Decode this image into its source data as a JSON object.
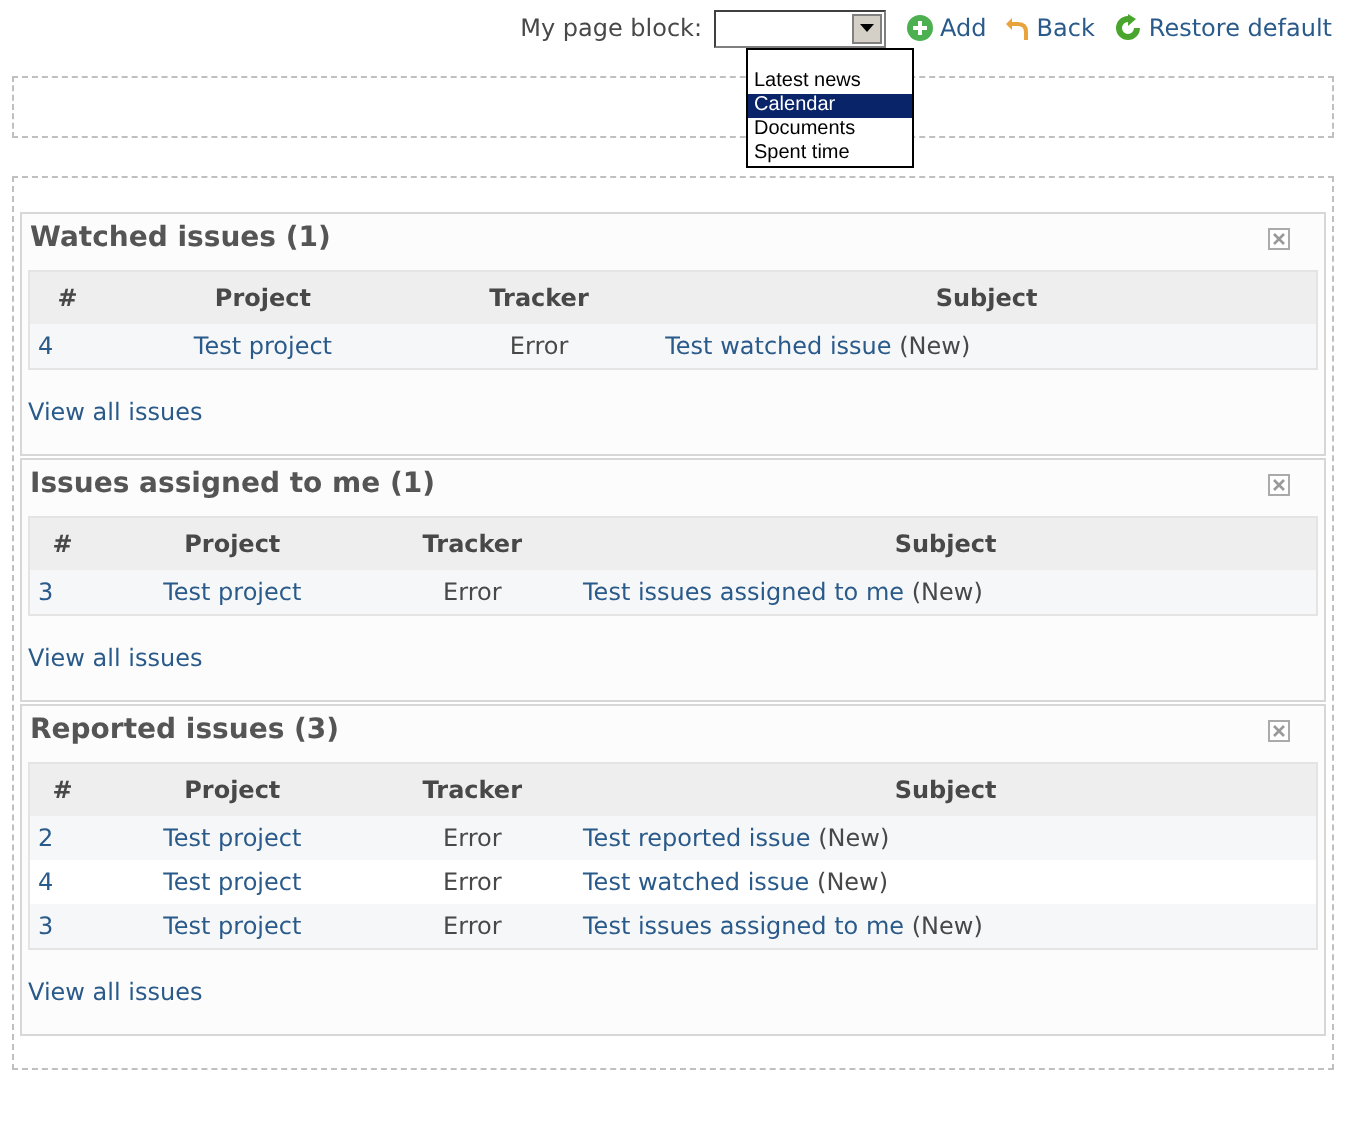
{
  "toolbar": {
    "label": "My page block:",
    "add": "Add",
    "back": "Back",
    "restore": "Restore default"
  },
  "block_menu": {
    "options": [
      {
        "label": "Latest news",
        "selected": false
      },
      {
        "label": "Calendar",
        "selected": true
      },
      {
        "label": "Documents",
        "selected": false
      },
      {
        "label": "Spent time",
        "selected": false
      }
    ]
  },
  "blocks": [
    {
      "title": "Watched issues (1)",
      "columns": [
        "#",
        "Project",
        "Tracker",
        "Subject"
      ],
      "rows": [
        {
          "id": "4",
          "project": "Test project",
          "tracker": "Error",
          "subject": "Test watched issue",
          "status": "(New)"
        }
      ],
      "footer_link": "View all issues"
    },
    {
      "title": "Issues assigned to me (1)",
      "columns": [
        "#",
        "Project",
        "Tracker",
        "Subject"
      ],
      "rows": [
        {
          "id": "3",
          "project": "Test project",
          "tracker": "Error",
          "subject": "Test issues assigned to me",
          "status": "(New)"
        }
      ],
      "footer_link": "View all issues"
    },
    {
      "title": "Reported issues (3)",
      "columns": [
        "#",
        "Project",
        "Tracker",
        "Subject"
      ],
      "rows": [
        {
          "id": "2",
          "project": "Test project",
          "tracker": "Error",
          "subject": "Test reported issue",
          "status": "(New)"
        },
        {
          "id": "4",
          "project": "Test project",
          "tracker": "Error",
          "subject": "Test watched issue",
          "status": "(New)"
        },
        {
          "id": "3",
          "project": "Test project",
          "tracker": "Error",
          "subject": "Test issues assigned to me",
          "status": "(New)"
        }
      ],
      "footer_link": "View all issues"
    }
  ]
}
